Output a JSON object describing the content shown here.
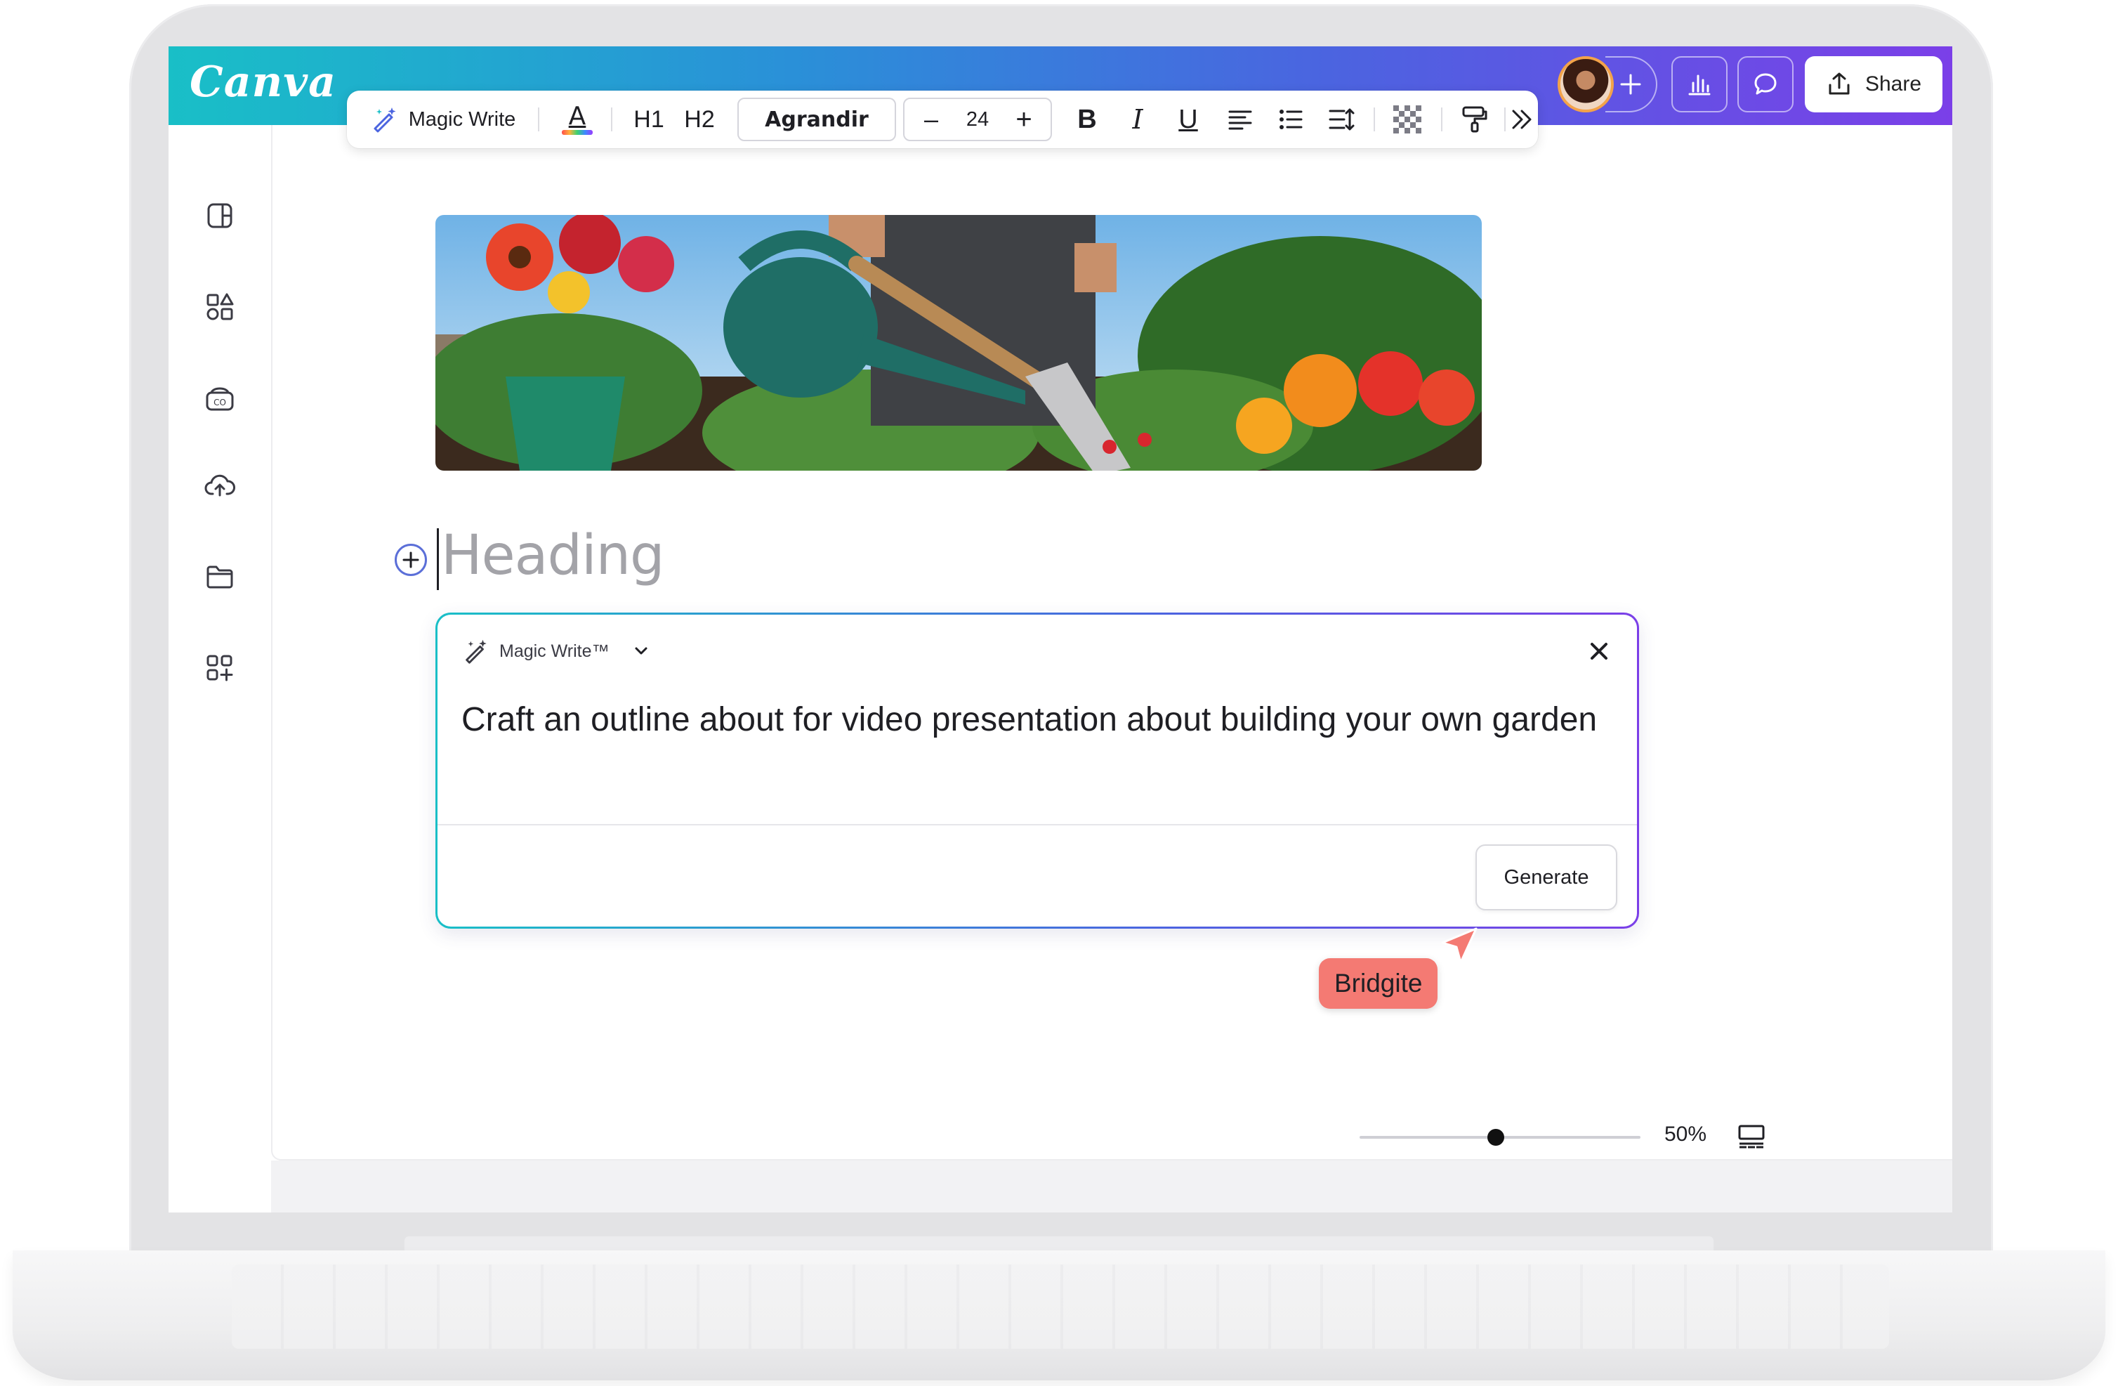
{
  "app": {
    "brand": "Canva",
    "share_label": "Share",
    "brand_gradient": [
      "#19bfc7",
      "#2a90d8",
      "#4b64e0",
      "#7b3fe8"
    ]
  },
  "topbar": {
    "icons": [
      "avatar",
      "add-icon",
      "insights-icon",
      "comment-icon",
      "share-icon"
    ]
  },
  "sidebar": {
    "items": [
      {
        "icon": "design-panel-icon"
      },
      {
        "icon": "elements-icon"
      },
      {
        "icon": "brand-kit-icon"
      },
      {
        "icon": "uploads-icon"
      },
      {
        "icon": "projects-folder-icon"
      },
      {
        "icon": "apps-icon"
      }
    ],
    "magic_icon": "magic-sparkle-icon"
  },
  "toolbar": {
    "magic_write_label": "Magic Write",
    "text_color_label": "A",
    "h1_label": "H1",
    "h2_label": "H2",
    "font_name": "Agrandir",
    "decrease_label": "–",
    "font_size": "24",
    "increase_label": "+",
    "bold_label": "B",
    "italic_label": "I",
    "underline_label": "U"
  },
  "document": {
    "image_alt": "garden photo",
    "heading_placeholder": "Heading"
  },
  "magic_write_panel": {
    "title": "Magic Write™",
    "prompt": "Craft an outline about for video presentation about building your own garden",
    "generate_label": "Generate",
    "collaborator_name": "Bridgite",
    "collaborator_color": "#f47a73"
  },
  "footer": {
    "zoom_value": "50%",
    "zoom_fraction": 0.5
  }
}
